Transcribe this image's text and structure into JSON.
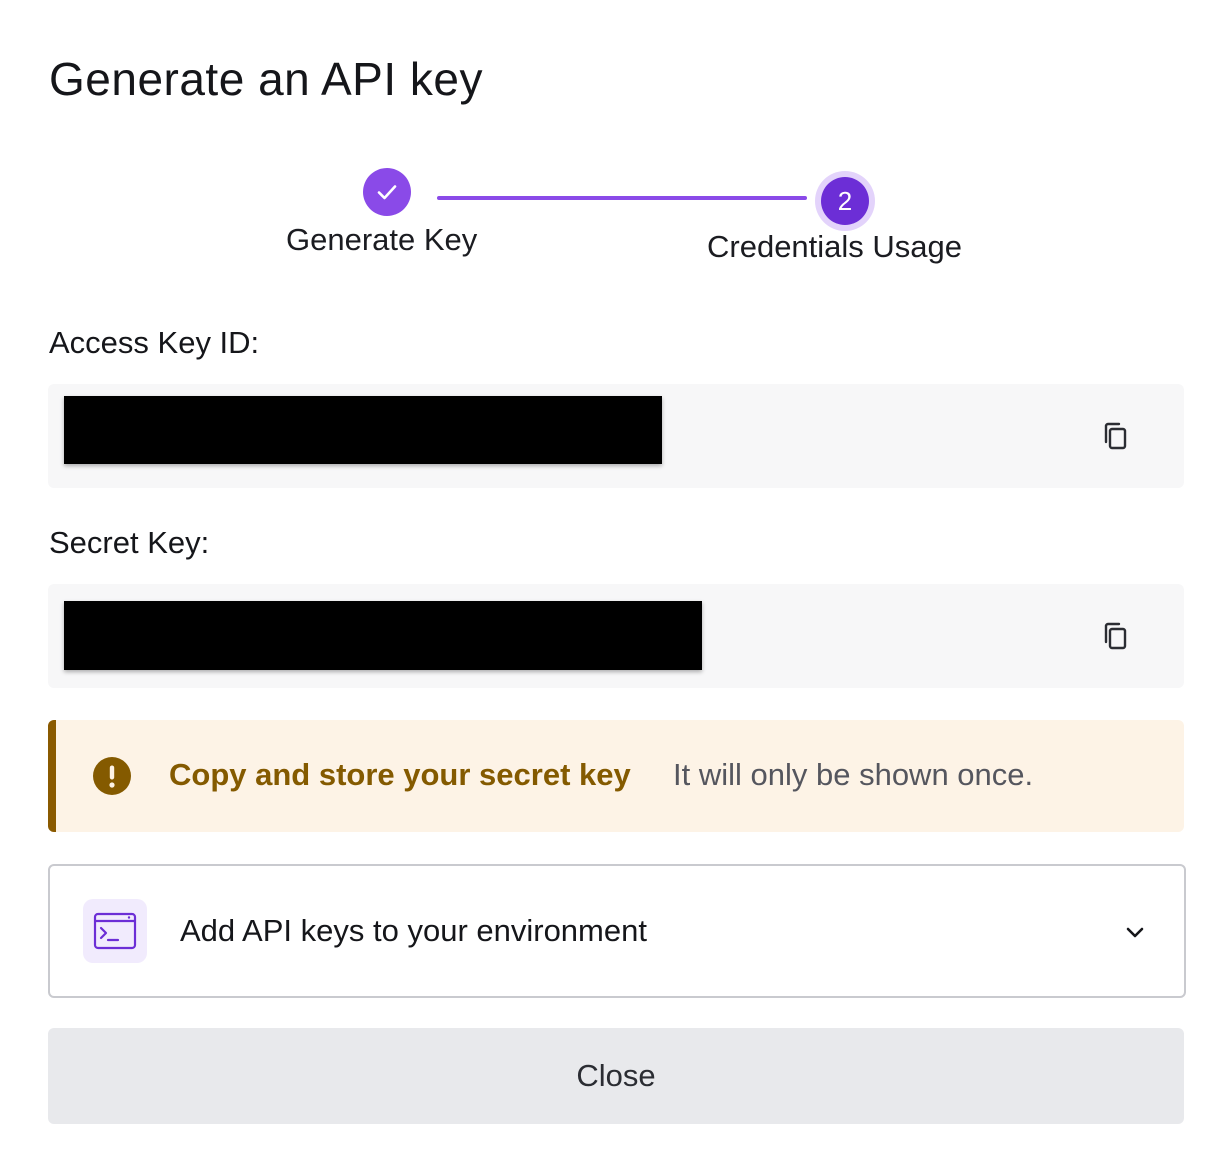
{
  "dialog": {
    "title": "Generate an API key"
  },
  "stepper": {
    "steps": [
      {
        "label": "Generate Key",
        "status": "completed"
      },
      {
        "label": "Credentials Usage",
        "number": "2",
        "status": "current"
      }
    ],
    "accent_color": "#8a4ae8"
  },
  "fields": {
    "access_key": {
      "label": "Access Key ID:",
      "value_redacted": true
    },
    "secret_key": {
      "label": "Secret Key:",
      "value_redacted": true
    }
  },
  "warning": {
    "title": "Copy and store your secret key",
    "message": "It will only be shown once.",
    "icon": "exclamation-circle-icon",
    "color": "#845a00"
  },
  "accordion": {
    "title": "Add API keys to your environment",
    "icon": "terminal-icon",
    "expanded": false
  },
  "footer": {
    "close_label": "Close"
  }
}
